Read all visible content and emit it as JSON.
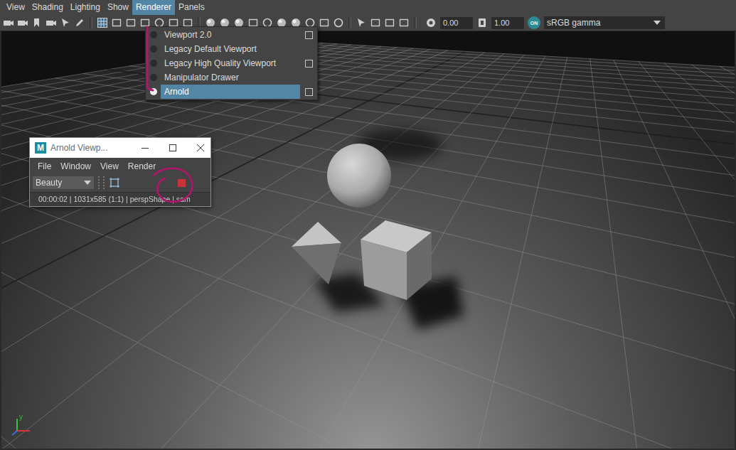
{
  "menu_bar": [
    {
      "label": "View",
      "selected": false
    },
    {
      "label": "Shading",
      "selected": false
    },
    {
      "label": "Lighting",
      "selected": false
    },
    {
      "label": "Show",
      "selected": false
    },
    {
      "label": "Renderer",
      "selected": true
    },
    {
      "label": "Panels",
      "selected": false
    }
  ],
  "toolbar": {
    "exposure": "0.00",
    "gamma": "1.00",
    "cm_toggle": "ON",
    "color_space": "sRGB gamma"
  },
  "renderer_menu": {
    "items": [
      {
        "label": "Viewport 2.0",
        "selected": false,
        "has_options": true
      },
      {
        "label": "Legacy Default Viewport",
        "selected": false,
        "has_options": false
      },
      {
        "label": "Legacy High Quality Viewport",
        "selected": false,
        "has_options": true
      },
      {
        "label": "Manipulator Drawer",
        "selected": false,
        "has_options": false
      },
      {
        "label": "Arnold",
        "selected": true,
        "has_options": true
      }
    ]
  },
  "arnold_window": {
    "logo": "M",
    "title": "Arnold Viewp...",
    "menu": [
      "File",
      "Window",
      "View",
      "Render"
    ],
    "aov": "Beauty",
    "rendering": true,
    "status": "00:00:02 | 1031x585 (1:1) | perspShape  | sam"
  },
  "axis": {
    "label": "y"
  }
}
